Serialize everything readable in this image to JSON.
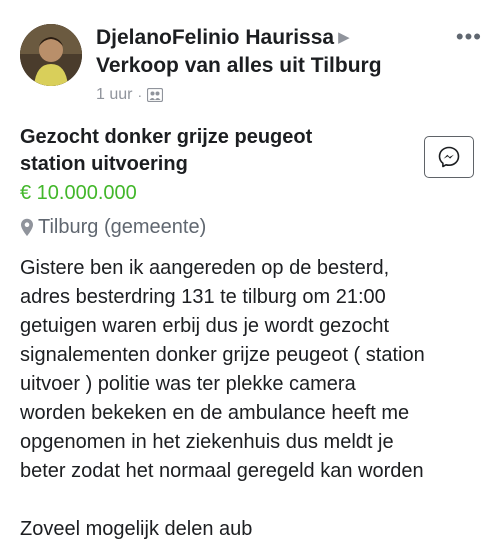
{
  "post": {
    "author": "DjelanoFelinio Haurissa",
    "group": "Verkoop van alles uit Tilburg",
    "time": "1 uur",
    "separator": "·"
  },
  "listing": {
    "title_line1": "Gezocht donker grijze peugeot",
    "title_line2": "station uitvoering",
    "price": "€ 10.000.000",
    "location": "Tilburg (gemeente)"
  },
  "body": {
    "lines": [
      "Gistere ben ik aangereden op de besterd,",
      "adres besterdring 131 te tilburg om 21:00",
      "getuigen waren erbij dus je wordt gezocht",
      "signalementen donker grijze peugeot ( station",
      "uitvoer ) politie was ter plekke camera",
      "worden bekeken en de ambulance heeft me",
      "opgenomen in het ziekenhuis dus meldt je",
      "beter zodat het normaal geregeld kan worden"
    ],
    "closing": "Zoveel mogelijk delen aub"
  },
  "icons": {
    "more": "more-options-icon",
    "messenger": "messenger-icon",
    "location": "location-pin-icon",
    "audience": "group-audience-icon",
    "arrow": "share-arrow-icon"
  },
  "colors": {
    "price": "#42b72a",
    "muted": "#90949c",
    "text": "#1c1e21"
  }
}
